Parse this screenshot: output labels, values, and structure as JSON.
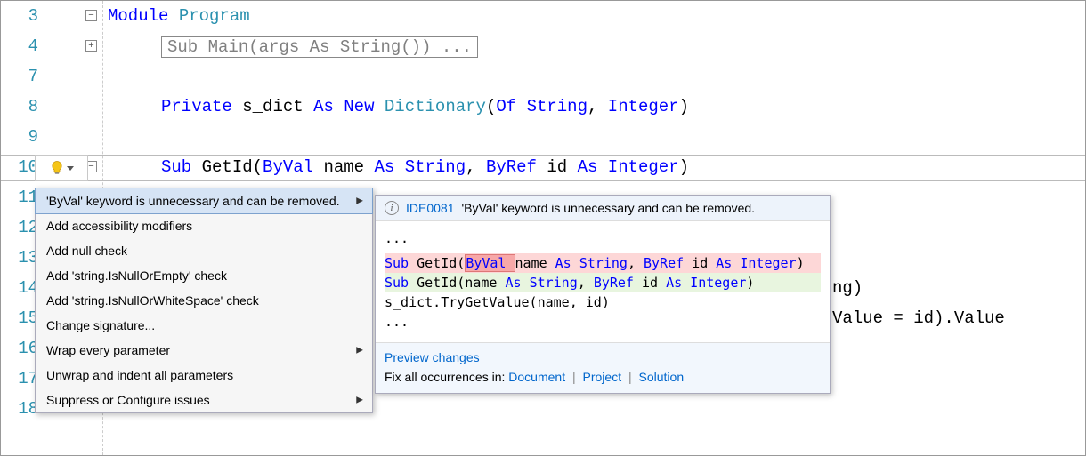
{
  "lines": {
    "l3": "3",
    "l4": "4",
    "l7": "7",
    "l8": "8",
    "l9": "9",
    "l10": "10",
    "l11": "11",
    "l12": "12",
    "l13": "13",
    "l14": "14",
    "l15": "15",
    "l16": "16",
    "l17": "17",
    "l18": "18"
  },
  "code": {
    "module_kw": "Module",
    "module_name": "Program",
    "collapsed_main": "Sub Main(args As String()) ...",
    "private_kw": "Private",
    "sdict_id": "s_dict",
    "as_kw": "As",
    "new_kw": "New",
    "dict_type": "Dictionary",
    "of_kw": "Of",
    "string_type": "String",
    "integer_type": "Integer",
    "comma": ", ",
    "lparen": "(",
    "rparen": ")",
    "sub_kw": "Sub",
    "getid": "GetId",
    "byval_kw": "ByVal",
    "byref_kw": "ByRef",
    "name_id": "name",
    "id_id": "id",
    "tail_14": "ng)",
    "tail_15": "Value = id).Value"
  },
  "quick_actions": {
    "items": [
      {
        "label": "'ByVal' keyword is unnecessary and can be removed.",
        "sub": true
      },
      {
        "label": "Add accessibility modifiers",
        "sub": false
      },
      {
        "label": "Add null check",
        "sub": false
      },
      {
        "label": "Add 'string.IsNullOrEmpty' check",
        "sub": false
      },
      {
        "label": "Add 'string.IsNullOrWhiteSpace' check",
        "sub": false
      },
      {
        "label": "Change signature...",
        "sub": false
      },
      {
        "label": "Wrap every parameter",
        "sub": true
      },
      {
        "label": "Unwrap and indent all parameters",
        "sub": false
      },
      {
        "label": "Suppress or Configure issues",
        "sub": true
      }
    ]
  },
  "preview": {
    "diag_id": "IDE0081",
    "diag_msg": "'ByVal' keyword is unnecessary and can be removed.",
    "ellipsis": "...",
    "diff": {
      "del_pre": "Sub ",
      "del_fn": "GetId",
      "del_lp": "(",
      "del_byval": "ByVal ",
      "del_rest_name": "name ",
      "del_as1": "As ",
      "del_str": "String",
      "del_mid": ", ",
      "del_byref": "ByRef",
      "del_id": " id ",
      "del_as2": "As ",
      "del_int": "Integer",
      "del_rp": ")",
      "add_pre": "Sub ",
      "add_fn": "GetId",
      "add_params1": "(name ",
      "add_as1": "As ",
      "add_str": "String",
      "add_mid": ", ",
      "add_byref": "ByRef",
      "add_id": " id ",
      "add_as2": "As ",
      "add_int": "Integer",
      "add_rp": ")",
      "ctx_line": "    s_dict.TryGetValue(name, id)"
    },
    "preview_changes": "Preview changes",
    "fix_label": "Fix all occurrences in:",
    "fix_doc": "Document",
    "fix_proj": "Project",
    "fix_sol": "Solution"
  }
}
